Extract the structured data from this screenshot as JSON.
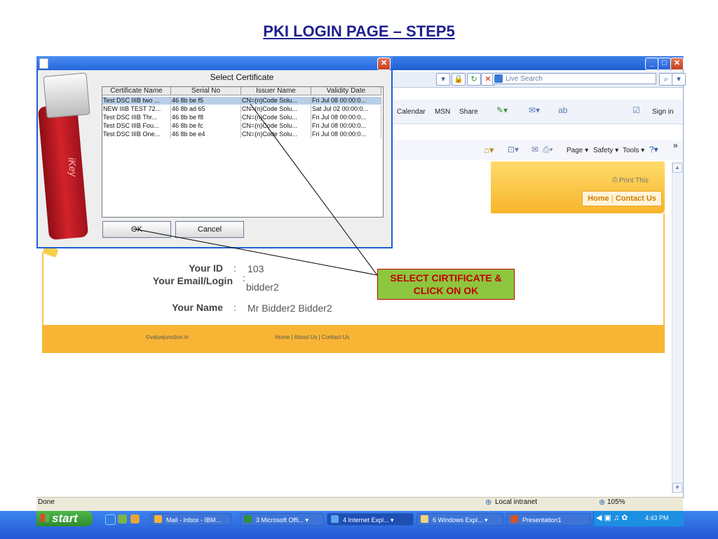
{
  "slide": {
    "title": "PKI LOGIN PAGE – STEP5"
  },
  "browser": {
    "search_placeholder": "Live Search",
    "links": [
      "Calendar",
      "MSN",
      "Share",
      "Sign in"
    ],
    "commands": [
      "Page",
      "Safety",
      "Tools"
    ],
    "status_text": "Done",
    "zone_text": "Local intranet",
    "zoom_text": "105%"
  },
  "page": {
    "print_label": "Print This",
    "nav": {
      "home": "Home",
      "separator": "|",
      "contact": "Contact Us"
    },
    "info": [
      {
        "label": "Your ID",
        "colon": ":",
        "value": "103"
      },
      {
        "label": "Your Email/Login",
        "colon": ":",
        "value": "bidder2"
      },
      {
        "label": "Your Name",
        "colon": ":",
        "value": "Mr Bidder2 Bidder2"
      }
    ],
    "footer": {
      "copyright": "©valuejunction.in",
      "links": "Home | About Us | Contact Us"
    }
  },
  "dialog": {
    "title": "Select Certificate",
    "usb_brand": "iKey",
    "columns": [
      "Certificate Name",
      "Serial No",
      "Issuer Name",
      "Validity Date"
    ],
    "rows": [
      [
        "Test DSC IIIB two ...",
        "46 8b be f5",
        "CN=(n)Code Solu...",
        "Fri Jul 08 00:00:0..."
      ],
      [
        "NEW IIIB TEST 72...",
        "46 8b ad 65",
        "CN=(n)Code Solu...",
        "Sat Jul 02 00:00:0..."
      ],
      [
        "Test DSC IIIB Thr...",
        "46 8b be f8",
        "CN=(n)Code Solu...",
        "Fri Jul 08 00:00:0..."
      ],
      [
        "Test DSC IIIB Fou...",
        "46 8b be fc",
        "CN=(n)Code Solu...",
        "Fri Jul 08 00:00:0..."
      ],
      [
        "Test DSC IIIB One...",
        "46 8b be e4",
        "CN=(n)Code Solu...",
        "Fri Jul 08 00:00:0..."
      ]
    ],
    "ok_label": "OK",
    "cancel_label": "Cancel"
  },
  "callout": {
    "line1": "SELECT CIRTIFICATE &",
    "line2": "CLICK ON OK"
  },
  "taskbar": {
    "start_label": "start",
    "tasks": [
      "Mail - Inbox - IBM...",
      "3 Microsoft Offi...",
      "4 Internet Expl...",
      "6 Windows Expl...",
      "Presentation1"
    ],
    "clock": "4:43 PM"
  },
  "colors": {
    "title_blue": "#1f1f8f",
    "callout_green": "#8ec63f",
    "callout_red": "#c00000",
    "footer_orange": "#f8b535"
  }
}
